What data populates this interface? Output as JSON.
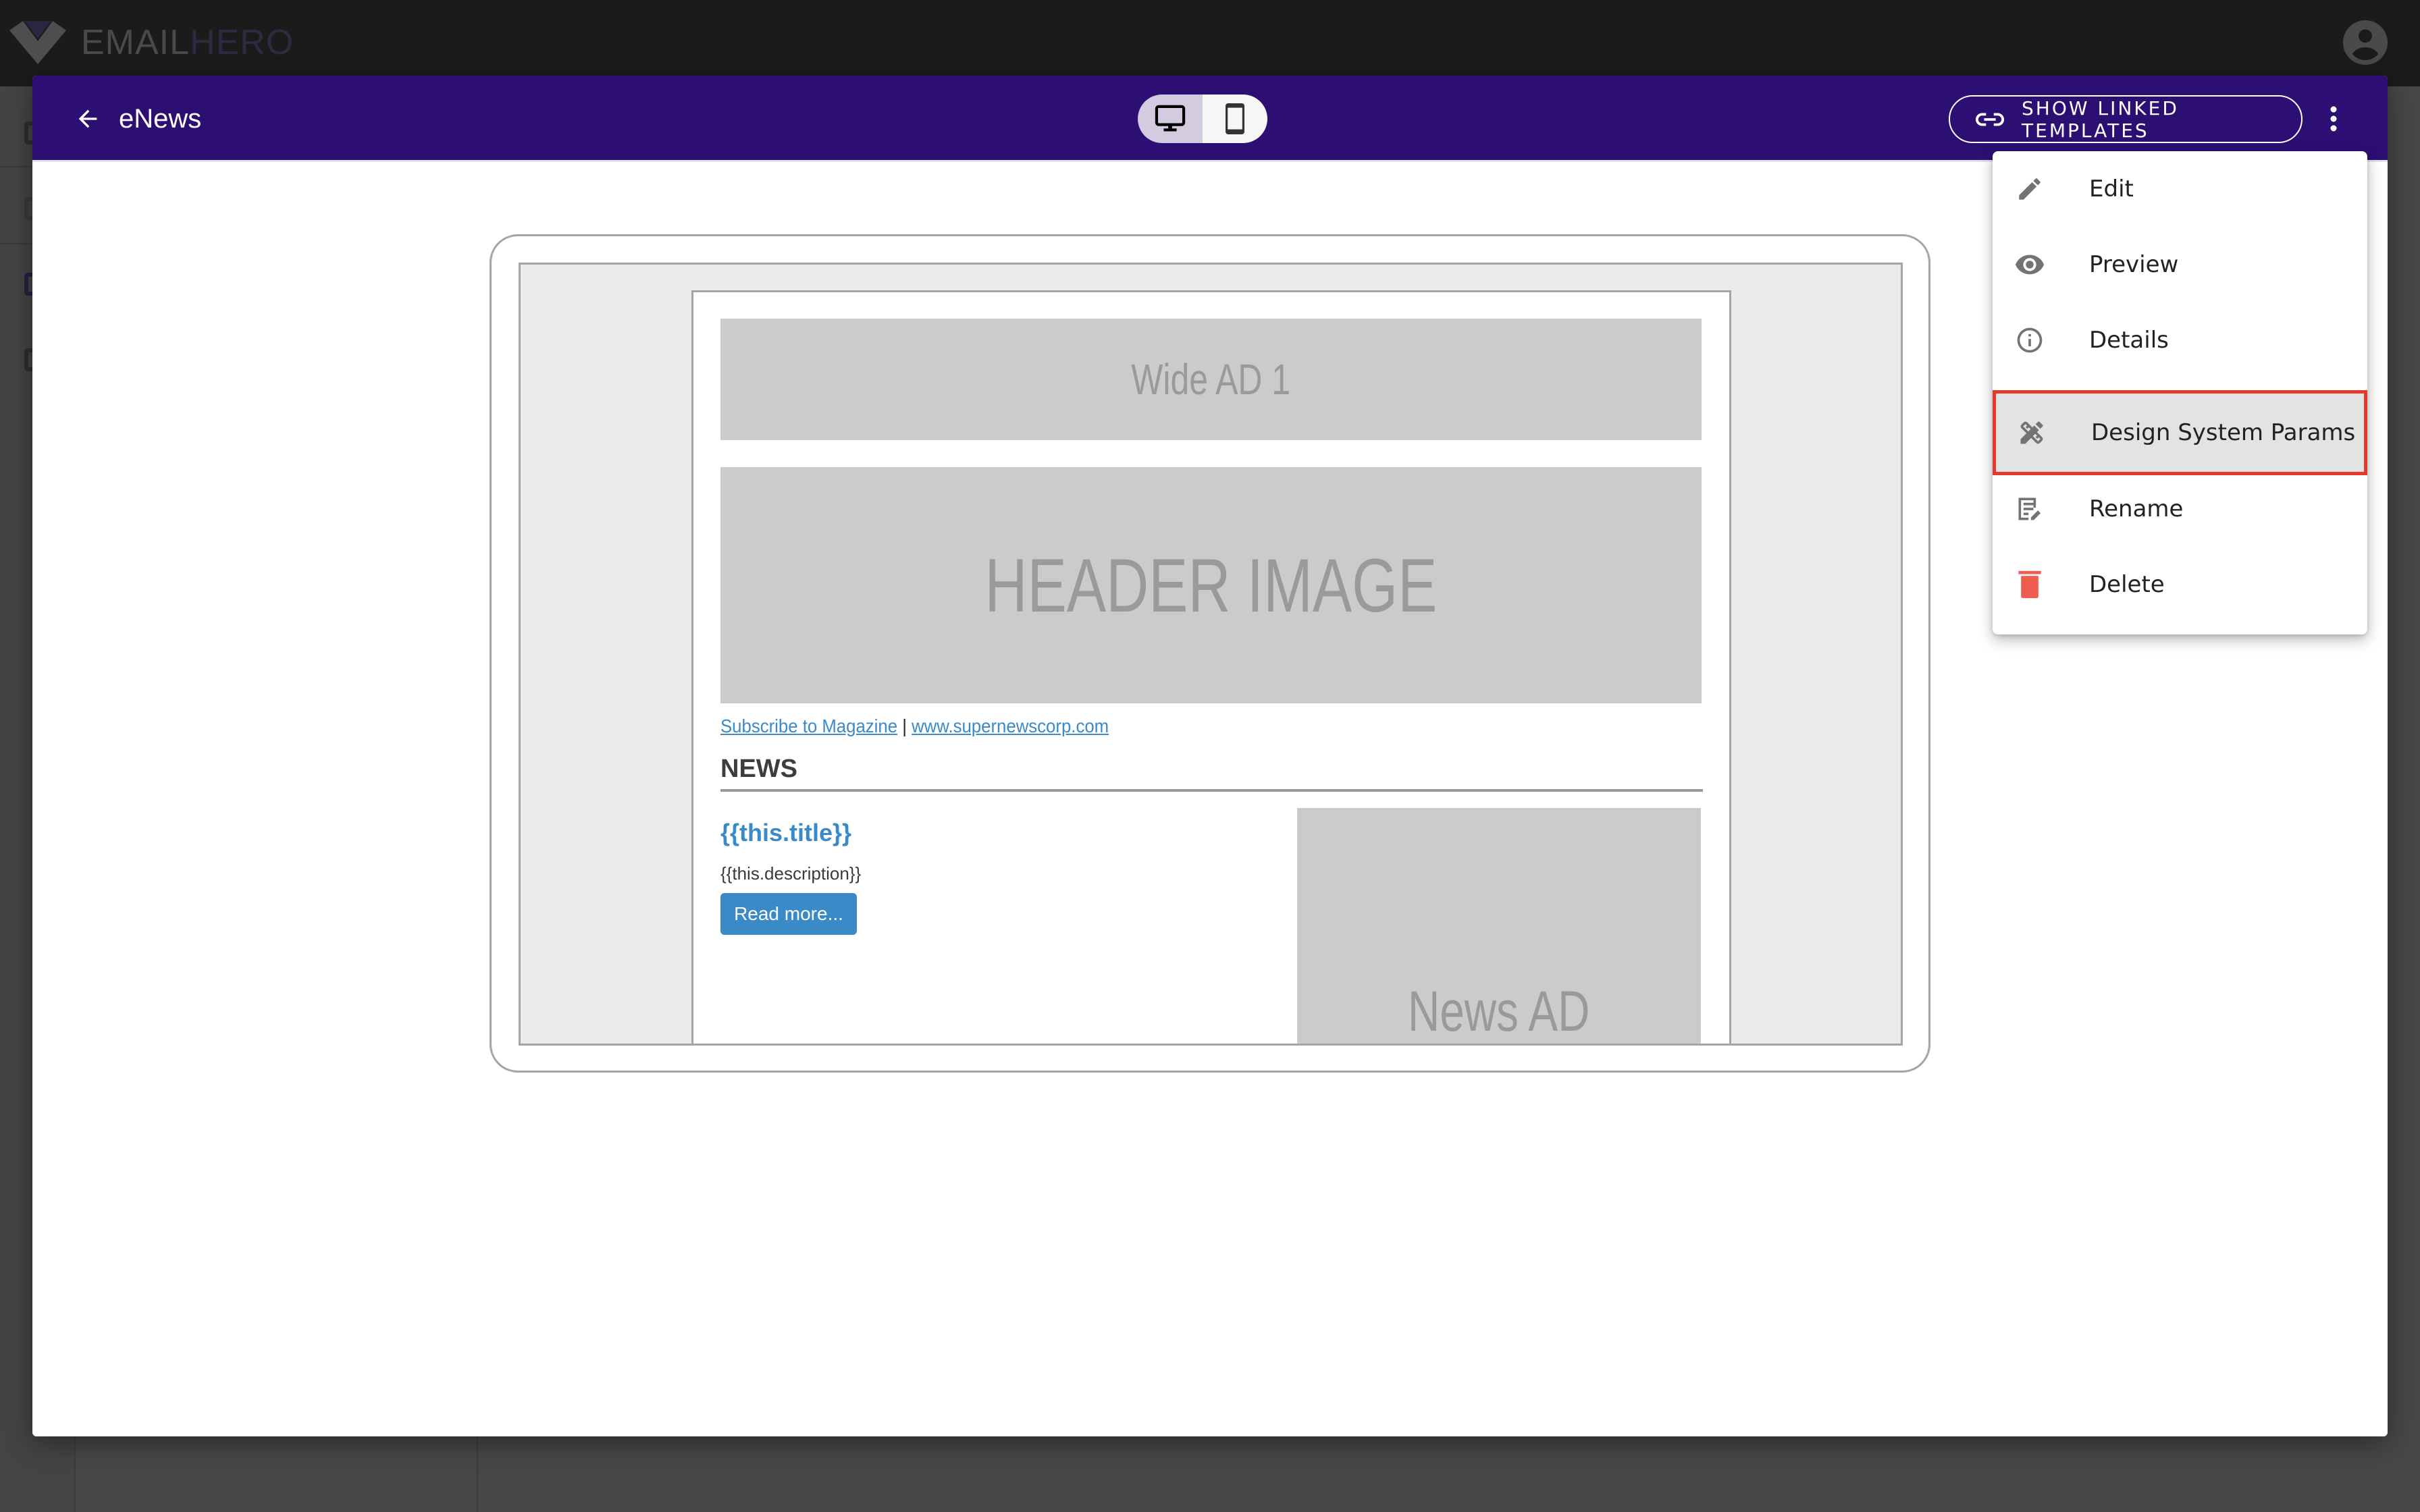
{
  "app": {
    "brand_part1": "EMAIL",
    "brand_part2": "HERO",
    "logo_icon": "chevron-v-logo",
    "account_icon": "account-circle-icon"
  },
  "modal": {
    "title": "eNews",
    "back_icon": "arrow-back-icon",
    "device_toggle": {
      "options": [
        {
          "name": "desktop",
          "icon": "desktop-icon",
          "active": true
        },
        {
          "name": "mobile",
          "icon": "mobile-icon",
          "active": false
        }
      ]
    },
    "linked_templates_button": {
      "label": "SHOW LINKED TEMPLATES",
      "icon": "link-icon"
    },
    "more_icon": "more-vert-icon",
    "colors": {
      "header_bg": "#2d0f74",
      "accent_link": "#3b8ac8",
      "highlight_border": "#e53a2a",
      "delete_icon": "#ef5d4f"
    }
  },
  "email_preview": {
    "wide_ad": "Wide AD 1",
    "header_image": "HEADER IMAGE",
    "subscribe_link": "Subscribe to Magazine",
    "separator": " | ",
    "website_link": "www.supernewscorp.com",
    "section_heading": "NEWS",
    "article": {
      "title": "{{this.title}}",
      "description": "{{this.description}}",
      "button": "Read more..."
    },
    "news_ad": "News AD"
  },
  "menu": {
    "items": [
      {
        "label": "Edit",
        "icon": "pencil-icon"
      },
      {
        "label": "Preview",
        "icon": "eye-icon"
      },
      {
        "label": "Details",
        "icon": "info-icon"
      },
      {
        "label": "Design System Params",
        "icon": "design-services-icon",
        "highlighted": true
      },
      {
        "label": "Rename",
        "icon": "rename-icon"
      },
      {
        "label": "Delete",
        "icon": "trash-icon"
      }
    ]
  }
}
